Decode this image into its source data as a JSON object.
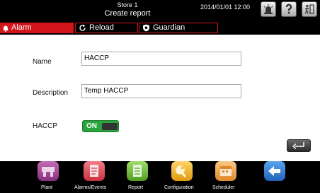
{
  "header": {
    "store": "Store 1",
    "title": "Create report",
    "datetime": "2014/01/01  12:00"
  },
  "tabs": {
    "alarm": "Alarm",
    "reload": "Reload",
    "guardian": "Guardian"
  },
  "form": {
    "name_label": "Name",
    "name_value": "HACCP",
    "description_label": "Description",
    "description_value": "Temp HACCP",
    "haccp_label": "HACCP",
    "haccp_toggle": "ON"
  },
  "nav": [
    {
      "label": "Plant",
      "icon": "plant-icon",
      "color": "#9b3c8c"
    },
    {
      "label": "Alarms/Events",
      "icon": "alarms-icon",
      "color": "#e24b58"
    },
    {
      "label": "Report",
      "icon": "report-icon",
      "color": "#6cbf3a"
    },
    {
      "label": "Configuration",
      "icon": "wrench-icon",
      "color": "#f0b323"
    },
    {
      "label": "Scheduler",
      "icon": "scheduler-icon",
      "color": "#f3a73b"
    },
    {
      "label": "",
      "icon": "back-arrow-icon",
      "color": "#2b7fd9"
    }
  ],
  "colors": {
    "accent_red": "#d2151c",
    "toggle_green": "#2aa33c"
  }
}
